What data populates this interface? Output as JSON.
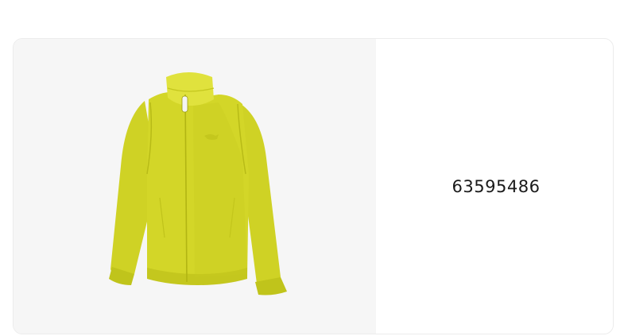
{
  "product": {
    "id": "63595486",
    "image_icon": "yellow-track-jacket-image",
    "colors": {
      "jacket_main": "#d3d628",
      "jacket_shade": "#b6ba16",
      "jacket_light": "#e0e23d",
      "image_background": "#f6f6f6"
    }
  }
}
